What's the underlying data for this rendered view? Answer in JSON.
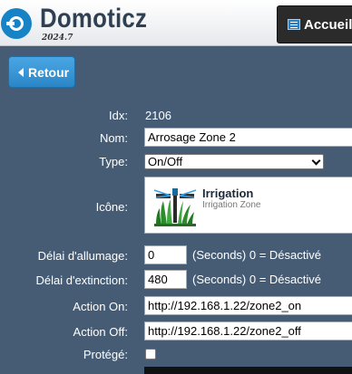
{
  "header": {
    "brand": "Domoticz",
    "version": "2024.7",
    "home_label": "Accueil"
  },
  "back_label": "Retour",
  "form": {
    "idx": {
      "label": "Idx:",
      "value": "2106"
    },
    "name": {
      "label": "Nom:",
      "value": "Arrosage Zone 2"
    },
    "type": {
      "label": "Type:",
      "value": "On/Off"
    },
    "icon": {
      "label": "Icône:",
      "title": "Irrigation",
      "subtitle": "Irrigation Zone"
    },
    "on_delay": {
      "label": "Délai d'allumage:",
      "value": "0",
      "hint": "(Seconds) 0 = Désactivé"
    },
    "off_delay": {
      "label": "Délai d'extinction:",
      "value": "480",
      "hint": "(Seconds) 0 = Désactivé"
    },
    "action_on": {
      "label": "Action On:",
      "value": "http://192.168.1.22/zone2_on"
    },
    "action_off": {
      "label": "Action Off:",
      "value": "http://192.168.1.22/zone2_off"
    },
    "protected": {
      "label": "Protégé:",
      "checked": false
    }
  },
  "colors": {
    "background": "#465c75",
    "accent": "#2a86c6",
    "brand": "#2f4052"
  }
}
